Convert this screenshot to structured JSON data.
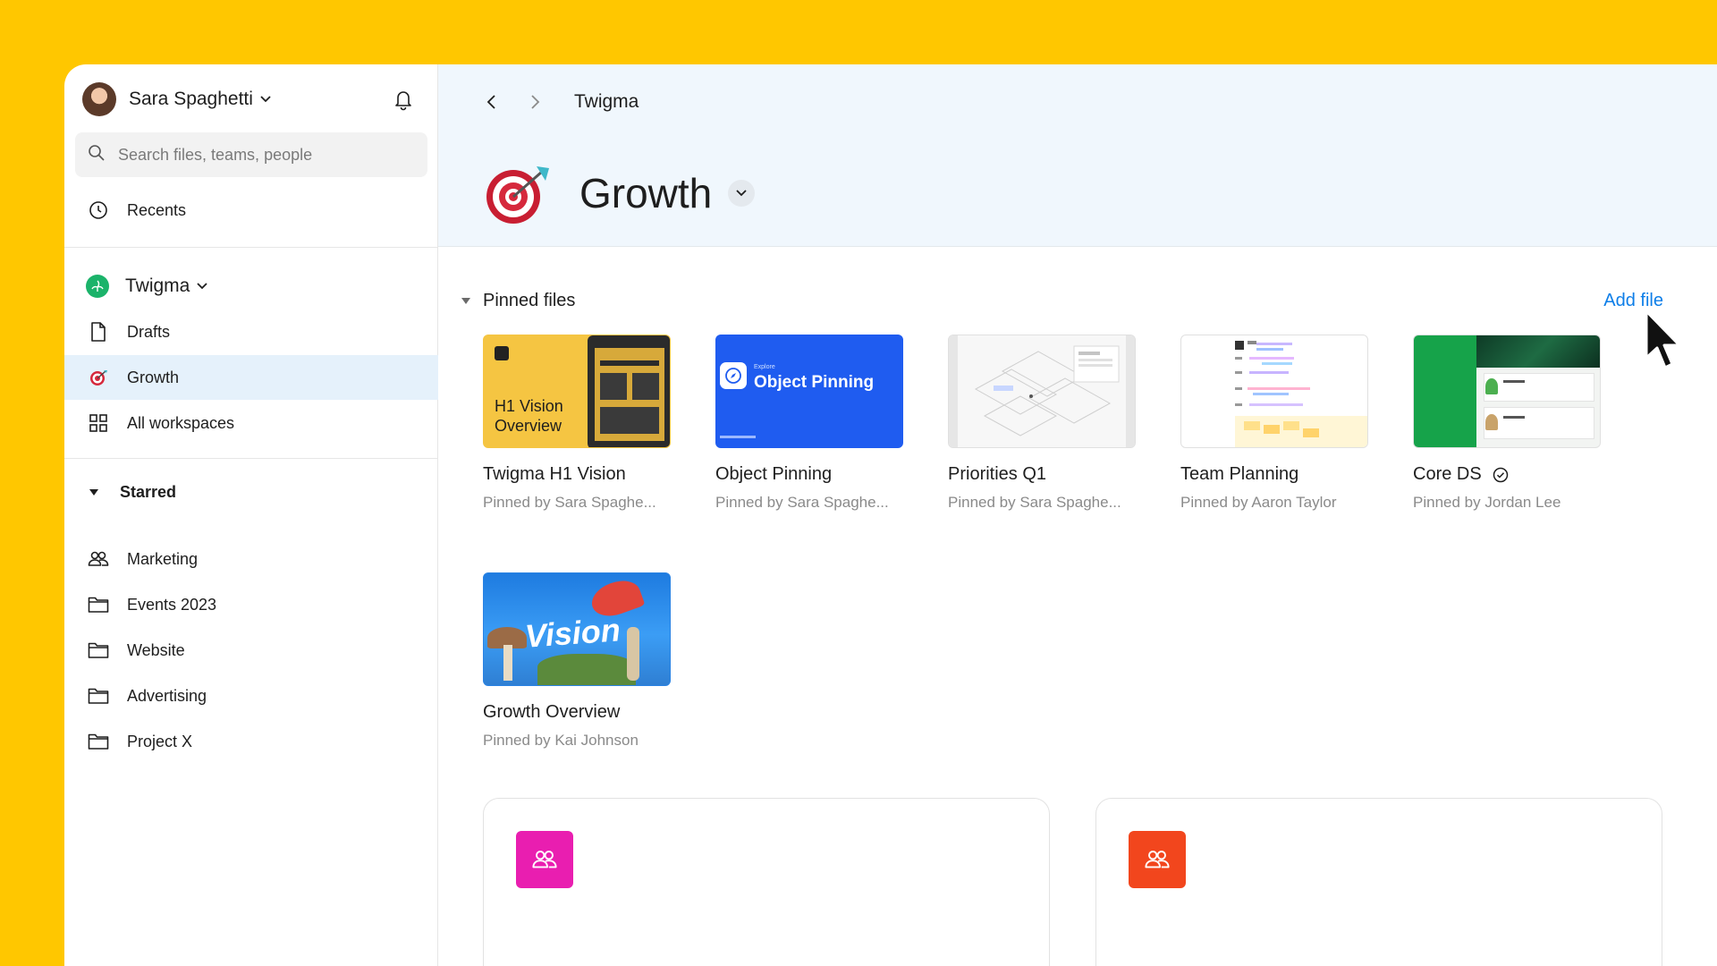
{
  "user": {
    "name": "Sara Spaghetti"
  },
  "search": {
    "placeholder": "Search files, teams, people"
  },
  "nav": {
    "recents": "Recents"
  },
  "team": {
    "name": "Twigma",
    "items": [
      {
        "label": "Drafts",
        "icon": "file-icon",
        "active": false
      },
      {
        "label": "Growth",
        "icon": "dart-icon",
        "active": true
      },
      {
        "label": "All workspaces",
        "icon": "grid-icon",
        "active": false
      }
    ]
  },
  "starred": {
    "label": "Starred",
    "items": [
      {
        "label": "Marketing",
        "icon": "people-icon"
      },
      {
        "label": "Events 2023",
        "icon": "folder-icon"
      },
      {
        "label": "Website",
        "icon": "folder-icon"
      },
      {
        "label": "Advertising",
        "icon": "folder-icon"
      },
      {
        "label": "Project X",
        "icon": "folder-icon"
      }
    ]
  },
  "header": {
    "breadcrumb": "Twigma",
    "title": "Growth"
  },
  "pinned": {
    "title": "Pinned files",
    "add_label": "Add file",
    "files": [
      {
        "title": "Twigma H1 Vision",
        "pinned_by": "Pinned by Sara Spaghe...",
        "thumb_text": "H1 Vision Overview"
      },
      {
        "title": "Object Pinning",
        "pinned_by": "Pinned by Sara Spaghe...",
        "thumb_kicker": "Explore",
        "thumb_text": "Object Pinning"
      },
      {
        "title": "Priorities Q1",
        "pinned_by": "Pinned by Sara Spaghe..."
      },
      {
        "title": "Team Planning",
        "pinned_by": "Pinned by Aaron Taylor"
      },
      {
        "title": "Core DS",
        "pinned_by": "Pinned by Jordan Lee",
        "verified": true
      },
      {
        "title": "Growth Overview",
        "pinned_by": "Pinned by Kai Johnson",
        "thumb_text": "Vision"
      }
    ]
  },
  "colors": {
    "accent": "#0d7ee8",
    "background": "#FFC700",
    "team_card_1": "#e91eb0",
    "team_card_2": "#f2461d"
  }
}
